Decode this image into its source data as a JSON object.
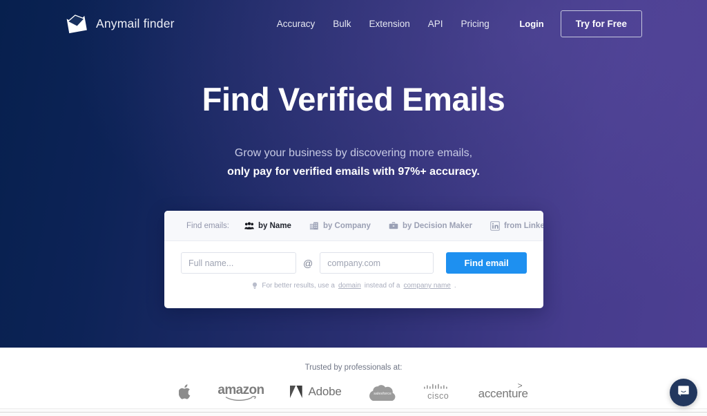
{
  "nav": {
    "brand": {
      "name": "Anymail finder",
      "icon": "envelope-icon"
    },
    "links": [
      {
        "label": "Accuracy"
      },
      {
        "label": "Bulk"
      },
      {
        "label": "Extension"
      },
      {
        "label": "API"
      },
      {
        "label": "Pricing"
      }
    ],
    "login_label": "Login",
    "cta_label": "Try for Free"
  },
  "hero": {
    "headline": "Find Verified Emails",
    "subline_1": "Grow your business by discovering more emails,",
    "subline_2": "only pay for verified emails with 97%+ accuracy.",
    "gradient_start": "#07204e",
    "gradient_end": "#4d3f92"
  },
  "search_card": {
    "find_label": "Find emails:",
    "tabs": [
      {
        "label": "by Name",
        "icon": "people-group-icon",
        "active": true
      },
      {
        "label": "by Company",
        "icon": "building-icon",
        "active": false
      },
      {
        "label": "by Decision Maker",
        "icon": "briefcase-icon",
        "active": false
      },
      {
        "label": "from LinkedIn",
        "icon": "linkedin-icon",
        "active": false
      }
    ],
    "name_input": {
      "value": "",
      "placeholder": "Full name..."
    },
    "at_symbol": "@",
    "domain_input": {
      "value": "",
      "placeholder": "company.com"
    },
    "submit_label": "Find email",
    "submit_color": "#1e90f0",
    "hint": {
      "icon": "lightbulb-icon",
      "prefix": "For better results, use a ",
      "link_1": "domain",
      "middle": " instead of a ",
      "link_2": "company name",
      "suffix": "."
    }
  },
  "trusted": {
    "title": "Trusted by professionals at:",
    "logos": [
      {
        "name": "apple-logo",
        "label": ""
      },
      {
        "name": "amazon-logo",
        "label": "amazon"
      },
      {
        "name": "adobe-logo",
        "label": "Adobe"
      },
      {
        "name": "salesforce-logo",
        "label": "salesforce"
      },
      {
        "name": "cisco-logo",
        "label": "cisco"
      },
      {
        "name": "accenture-logo",
        "label": "accenture"
      }
    ]
  },
  "chat": {
    "icon": "chat-bubble-icon",
    "color": "#22375e"
  }
}
